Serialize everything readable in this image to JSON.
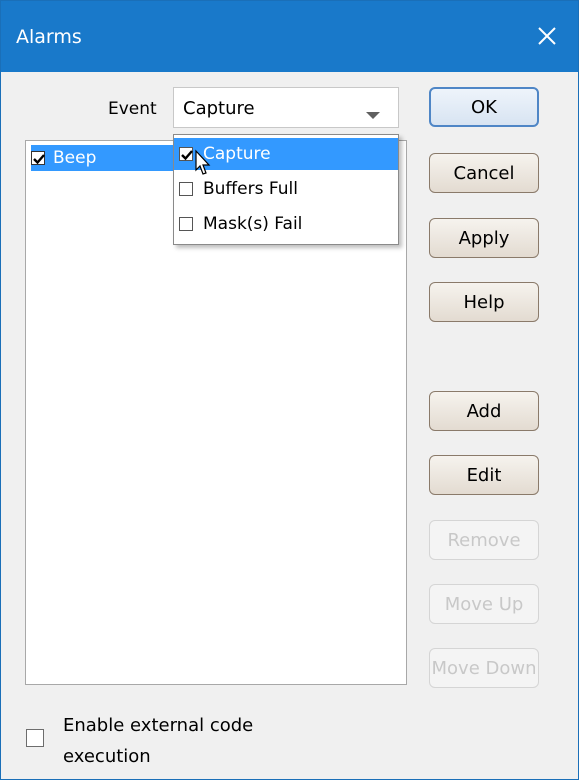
{
  "window": {
    "title": "Alarms"
  },
  "event": {
    "label": "Event",
    "selected": "Capture",
    "options": [
      {
        "label": "Capture",
        "checked": true,
        "highlighted": true
      },
      {
        "label": "Buffers Full",
        "checked": false,
        "highlighted": false
      },
      {
        "label": "Mask(s) Fail",
        "checked": false,
        "highlighted": false
      }
    ]
  },
  "alarms_list": {
    "items": [
      {
        "label": "Beep",
        "checked": true,
        "selected": true
      }
    ]
  },
  "buttons": {
    "ok": "OK",
    "cancel": "Cancel",
    "apply": "Apply",
    "help": "Help",
    "add": "Add",
    "edit": "Edit",
    "remove": "Remove",
    "move_up": "Move Up",
    "move_down": "Move Down"
  },
  "external_code": {
    "label": "Enable external code execution",
    "checked": false
  },
  "colors": {
    "titlebar": "#1979ca",
    "selection": "#3399ff",
    "dialog_bg": "#f0f0f0"
  }
}
